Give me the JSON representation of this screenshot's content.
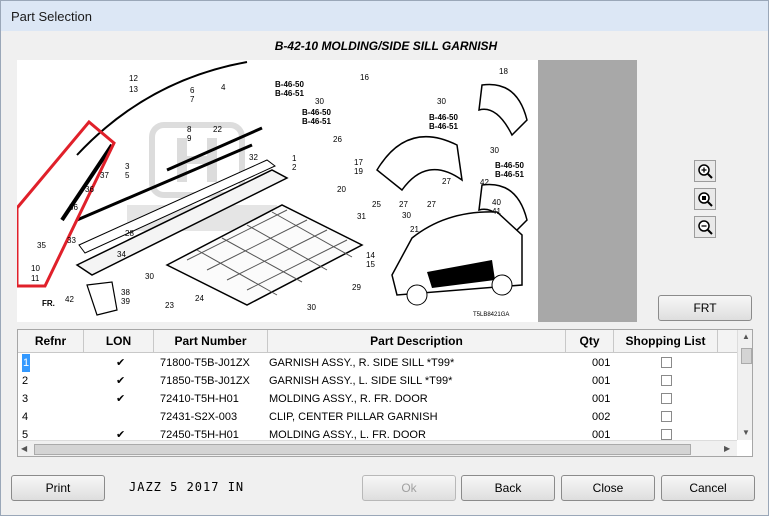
{
  "window": {
    "title": "Part Selection"
  },
  "diagram": {
    "title": "B-42-10 MOLDING/SIDE SILL GARNISH",
    "image_code": "T5LB8421GA",
    "callouts": [
      "1",
      "2",
      "3",
      "5",
      "6",
      "7",
      "8",
      "9",
      "10",
      "11",
      "12",
      "13",
      "14",
      "15",
      "16",
      "17",
      "18",
      "19",
      "20",
      "21",
      "22",
      "23",
      "24",
      "25",
      "26",
      "27",
      "28",
      "29",
      "30",
      "31",
      "32",
      "33",
      "34",
      "35",
      "36",
      "37",
      "38",
      "39",
      "40",
      "41",
      "42"
    ],
    "refs": [
      "B-46-50",
      "B-46-51"
    ],
    "front_marker": "FR."
  },
  "zoom": {
    "zoom_in_icon": "zoom-in-icon",
    "zoom_fit_icon": "zoom-fit-icon",
    "zoom_out_icon": "zoom-out-icon"
  },
  "buttons": {
    "frt": "FRT",
    "print": "Print",
    "ok": "Ok",
    "back": "Back",
    "close": "Close",
    "cancel": "Cancel"
  },
  "table": {
    "headers": {
      "refnr": "Refnr",
      "lon": "LON",
      "part_number": "Part Number",
      "description": "Part Description",
      "qty": "Qty",
      "shopping": "Shopping List"
    },
    "rows": [
      {
        "refnr": "1",
        "lon": "✔",
        "part_number": "71800-T5B-J01ZX",
        "description": "GARNISH ASSY., R. SIDE SILL *T99*",
        "qty": "001"
      },
      {
        "refnr": "2",
        "lon": "✔",
        "part_number": "71850-T5B-J01ZX",
        "description": "GARNISH ASSY., L. SIDE SILL *T99*",
        "qty": "001"
      },
      {
        "refnr": "3",
        "lon": "✔",
        "part_number": "72410-T5H-H01",
        "description": "MOLDING ASSY., R. FR. DOOR",
        "qty": "001"
      },
      {
        "refnr": "4",
        "lon": "",
        "part_number": "72431-S2X-003",
        "description": "CLIP, CENTER PILLAR GARNISH",
        "qty": "002"
      },
      {
        "refnr": "5",
        "lon": "✔",
        "part_number": "72450-T5H-H01",
        "description": "MOLDING ASSY., L. FR. DOOR",
        "qty": "001"
      }
    ]
  },
  "status": {
    "vehicle": "JAZZ 5 2017 IN"
  },
  "colors": {
    "highlight": "#e0202a",
    "selection": "#3399ff",
    "panel_gray": "#a8a8a8"
  }
}
